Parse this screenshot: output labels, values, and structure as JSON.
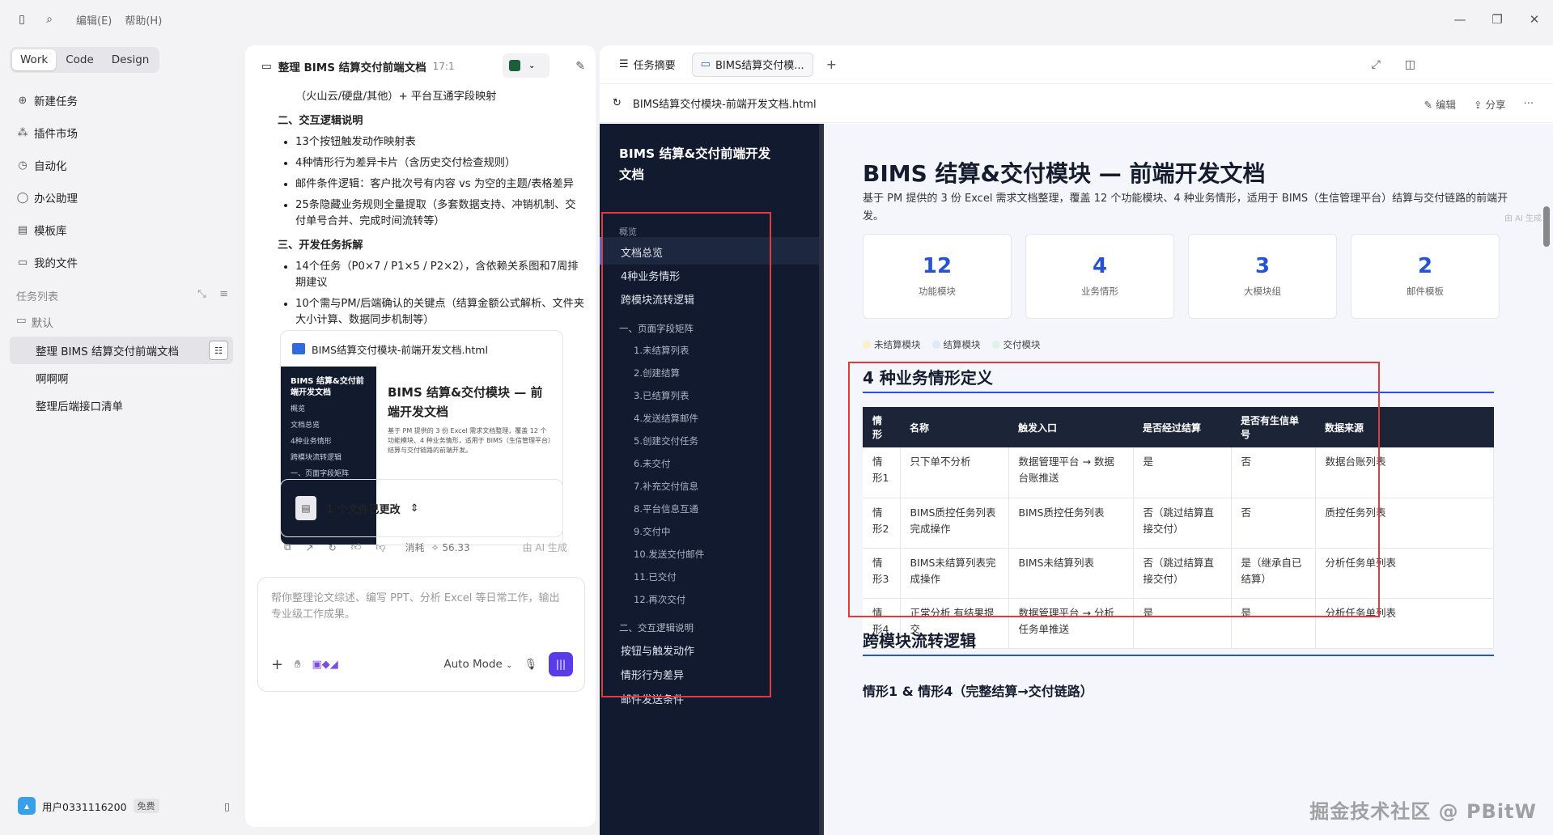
{
  "titlebar": {
    "menus": [
      "编辑(E)",
      "帮助(H)"
    ]
  },
  "modes": [
    "Work",
    "Code",
    "Design"
  ],
  "nav": [
    {
      "icon": "plus-circle-icon",
      "label": "新建任务"
    },
    {
      "icon": "plugin-icon",
      "label": "插件市场"
    },
    {
      "icon": "clock-icon",
      "label": "自动化"
    },
    {
      "icon": "chat-icon",
      "label": "办公助理"
    },
    {
      "icon": "template-icon",
      "label": "模板库"
    },
    {
      "icon": "file-icon",
      "label": "我的文件"
    }
  ],
  "tasks_section": {
    "title": "任务列表",
    "folder": "默认",
    "items": [
      "整理 BIMS 结算交付前端文档",
      "啊啊啊",
      "整理后端接口清单"
    ]
  },
  "user": {
    "name": "用户0331116200",
    "tag": "免费"
  },
  "chat": {
    "title": "整理 BIMS 结算交付前端文档",
    "time": "17:1",
    "lines": [
      "（火山云/硬盘/其他）+ 平台互通字段映射"
    ],
    "h_interact": "二、交互逻辑说明",
    "interact": [
      "13个按钮触发动作映射表",
      "4种情形行为差异卡片（含历史交付检查规则）",
      "邮件条件逻辑：客户批次号有内容 vs 为空的主题/表格差异",
      "25条隐藏业务规则全量提取（多套数据支持、冲销机制、交付单号合并、完成时间流转等）"
    ],
    "h_tasks": "三、开发任务拆解",
    "tasks": [
      "14个任务（P0×7 / P1×5 / P2×2），含依赖关系图和7周排期建议",
      "10个需与PM/后端确认的关键点（结算金额公式解析、文件夹大小计算、数据同步机制等）"
    ],
    "file_name": "BIMS结算交付模块-前端开发文档.html",
    "thumb_brand": "BIMS 结算&交付前端开发文档",
    "thumb_title": "BIMS 结算&交付模块 — 前端开发文档",
    "thumb_items": [
      "概览",
      "文档总览",
      "4种业务情形",
      "跨模块流转逻辑",
      "一、页面字段矩阵"
    ],
    "changed": "1 个文件已更改",
    "cost_label": "消耗",
    "cost": "56.33",
    "ai_mark": "由 AI 生成",
    "placeholder": "帮你整理论文综述、编写 PPT、分析 Excel 等日常工作，输出专业级工作成果。",
    "mode": "Auto Mode"
  },
  "preview": {
    "tabs": [
      "任务摘要",
      "BIMS结算交付模..."
    ],
    "addr": "BIMS结算交付模块-前端开发文档.html",
    "edit": "编辑",
    "share": "分享"
  },
  "doc": {
    "brand": "BIMS 结算&交付前端开发文档",
    "overview": "概览",
    "nav_top": [
      "文档总览",
      "4种业务情形",
      "跨模块流转逻辑"
    ],
    "grp1": "一、页面字段矩阵",
    "subs": [
      "1.未结算列表",
      "2.创建结算",
      "3.已结算列表",
      "4.发送结算邮件",
      "5.创建交付任务",
      "6.未交付",
      "7.补充交付信息",
      "8.平台信息互通",
      "9.交付中",
      "10.发送交付邮件",
      "11.已交付",
      "12.再次交付"
    ],
    "grp2": "二、交互逻辑说明",
    "nav_bottom": [
      "按钮与触发动作",
      "情形行为差异",
      "邮件发送条件"
    ],
    "title": "BIMS 结算&交付模块 — 前端开发文档",
    "intro": "基于 PM 提供的 3 份 Excel 需求文档整理，覆盖 12 个功能模块、4 种业务情形，适用于 BIMS（生信管理平台）结算与交付链路的前端开发。",
    "stats": [
      {
        "n": "12",
        "l": "功能模块"
      },
      {
        "n": "4",
        "l": "业务情形"
      },
      {
        "n": "3",
        "l": "大模块组"
      },
      {
        "n": "2",
        "l": "邮件模板"
      }
    ],
    "legend": [
      {
        "label": "未结算模块",
        "color": "#fcefc7"
      },
      {
        "label": "结算模块",
        "color": "#dde8fb"
      },
      {
        "label": "交付模块",
        "color": "#ddf3e4"
      }
    ],
    "h_cases": "4 种业务情形定义",
    "table_head": [
      "情形",
      "名称",
      "触发入口",
      "是否经过结算",
      "是否有生信单号",
      "数据来源"
    ],
    "table_rows": [
      [
        "情形1",
        "只下单不分析",
        "数据管理平台 → 数据台账推送",
        "是",
        "否",
        "数据台账列表"
      ],
      [
        "情形2",
        "BIMS质控任务列表完成操作",
        "BIMS质控任务列表",
        "否（跳过结算直接交付）",
        "否",
        "质控任务列表"
      ],
      [
        "情形3",
        "BIMS未结算列表完成操作",
        "BIMS未结算列表",
        "否（跳过结算直接交付）",
        "是（继承自已结算）",
        "分析任务单列表"
      ],
      [
        "情形4",
        "正常分析 有结果提交",
        "数据管理平台 → 分析任务单推送",
        "是",
        "是",
        "分析任务单列表"
      ]
    ],
    "h_flow": "跨模块流转逻辑",
    "h_flow_sub": "情形1 & 情形4（完整结算→交付链路）",
    "watermark": "掘金技术社区 @ PBitW",
    "ai_mark": "由 AI 生成"
  }
}
